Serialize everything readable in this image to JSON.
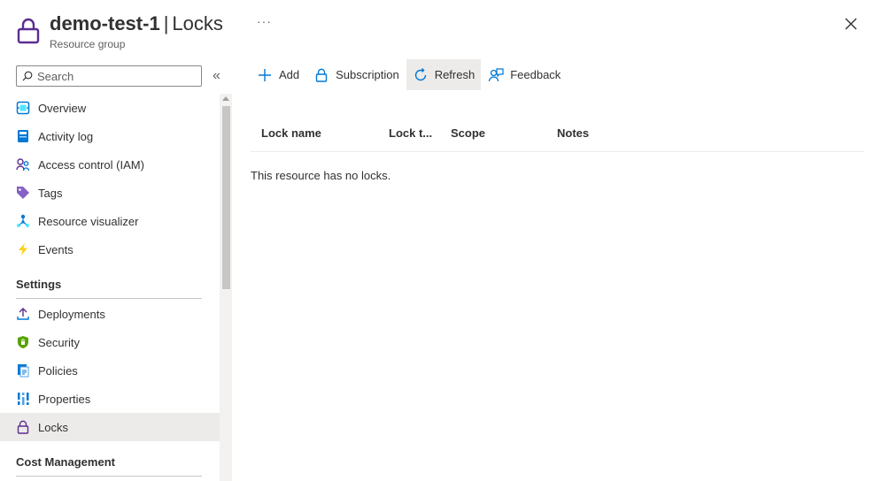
{
  "header": {
    "resource_name": "demo-test-1",
    "separator": "|",
    "page_title": "Locks",
    "subtitle": "Resource group",
    "more_label": "···",
    "icon": "lock-icon",
    "close_icon": "close-icon"
  },
  "sidebar": {
    "search_placeholder": "Search",
    "collapse_label": "«",
    "items": [
      {
        "label": "Overview",
        "icon": "overview-icon"
      },
      {
        "label": "Activity log",
        "icon": "activity-log-icon"
      },
      {
        "label": "Access control (IAM)",
        "icon": "iam-icon"
      },
      {
        "label": "Tags",
        "icon": "tag-icon"
      },
      {
        "label": "Resource visualizer",
        "icon": "visualizer-icon"
      },
      {
        "label": "Events",
        "icon": "lightning-icon"
      }
    ],
    "settings_heading": "Settings",
    "settings_items": [
      {
        "label": "Deployments",
        "icon": "upload-icon"
      },
      {
        "label": "Security",
        "icon": "shield-icon"
      },
      {
        "label": "Policies",
        "icon": "policy-icon"
      },
      {
        "label": "Properties",
        "icon": "properties-icon"
      },
      {
        "label": "Locks",
        "icon": "lock-icon",
        "active": true
      }
    ],
    "cost_heading": "Cost Management"
  },
  "toolbar": {
    "add_label": "Add",
    "subscription_label": "Subscription",
    "refresh_label": "Refresh",
    "feedback_label": "Feedback"
  },
  "table": {
    "columns": [
      "Lock name",
      "Lock t...",
      "Scope",
      "Notes"
    ],
    "empty_message": "This resource has no locks."
  },
  "colors": {
    "accent": "#0078d4",
    "lock_purple": "#5c2d91",
    "active_bg": "#edebe9"
  }
}
